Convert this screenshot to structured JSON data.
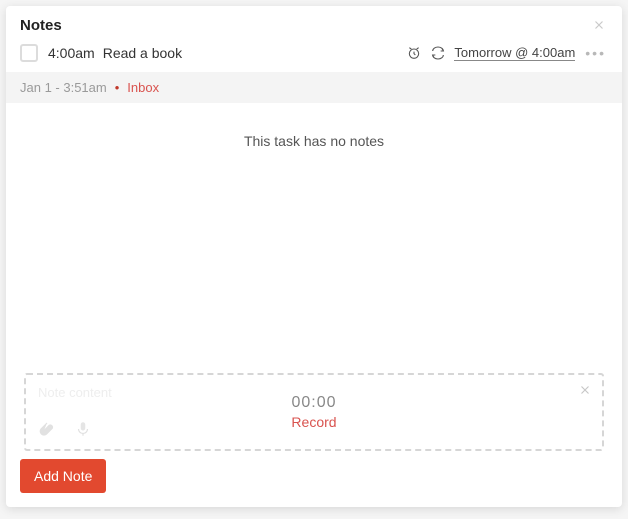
{
  "header": {
    "title": "Notes"
  },
  "task": {
    "time": "4:00am",
    "title": "Read a book",
    "due": "Tomorrow @ 4:00am"
  },
  "meta": {
    "created": "Jan 1 - 3:51am",
    "separator": "•",
    "project": "Inbox"
  },
  "body": {
    "empty_message": "This task has no notes"
  },
  "note_input": {
    "placeholder": "Note content",
    "timer": "00:00",
    "record_label": "Record"
  },
  "footer": {
    "add_label": "Add Note"
  }
}
